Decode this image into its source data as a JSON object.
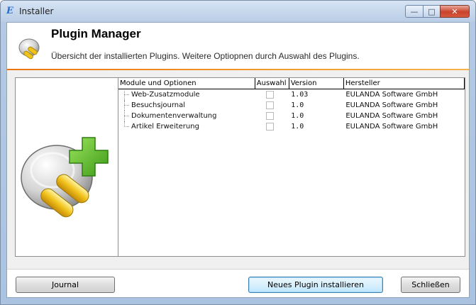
{
  "window": {
    "title": "Installer",
    "app_icon": "E"
  },
  "window_controls": {
    "minimize": "—",
    "maximize": "□",
    "close": "✕"
  },
  "header": {
    "title": "Plugin Manager",
    "subtitle": "Übersicht der installierten Plugins. Weitere Optiopnen durch Auswahl des Plugins."
  },
  "table": {
    "columns": [
      "Module und Optionen",
      "Auswahl",
      "Version",
      "Hersteller"
    ],
    "rows": [
      {
        "name": "Web-Zusatzmodule",
        "checked": false,
        "version": "1.03",
        "vendor": "EULANDA Software GmbH"
      },
      {
        "name": "Besuchsjournal",
        "checked": false,
        "version": "1.0",
        "vendor": "EULANDA Software GmbH"
      },
      {
        "name": "Dokumentenverwaltung",
        "checked": false,
        "version": "1.0",
        "vendor": "EULANDA Software GmbH"
      },
      {
        "name": "Artikel Erweiterung",
        "checked": false,
        "version": "1.0",
        "vendor": "EULANDA Software GmbH"
      }
    ]
  },
  "buttons": {
    "journal": "Journal",
    "install": "Neues Plugin installieren",
    "close": "Schließen"
  },
  "colors": {
    "accent_line": "#e9760f",
    "plus_green": "#5fbf2a",
    "plug_yellow": "#f1c21a"
  }
}
